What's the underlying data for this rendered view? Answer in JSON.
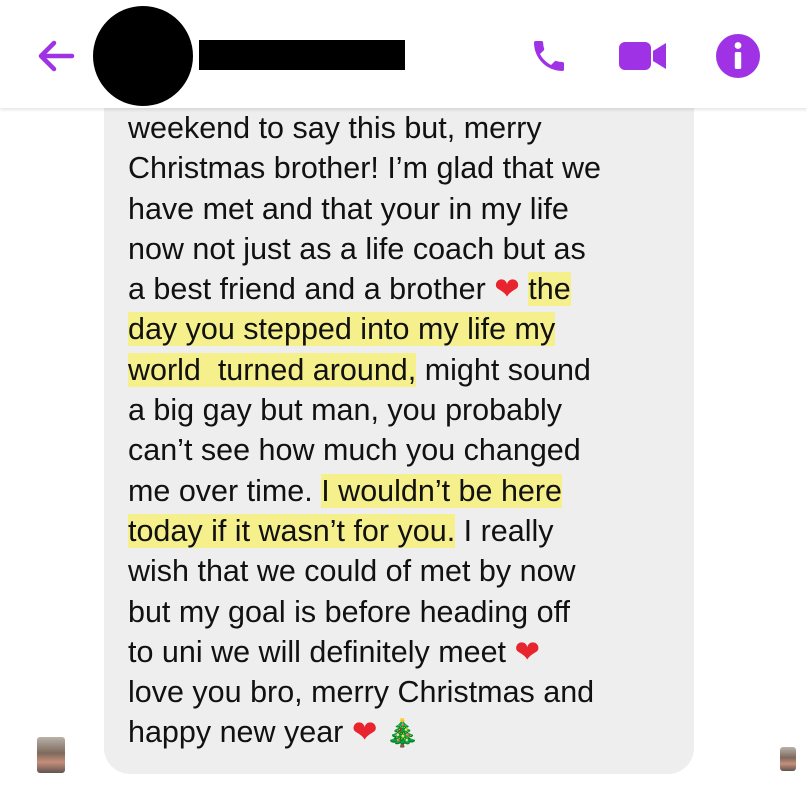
{
  "header": {
    "back_icon": "back-arrow-icon",
    "call_icon": "phone-icon",
    "video_icon": "video-camera-icon",
    "info_icon": "info-icon",
    "accent_color": "#a032e6"
  },
  "message": {
    "segments": [
      {
        "text": "weekend to say this but, merry\nChristmas brother! I’m glad that we\nhave met and that your in my life\nnow not just as a life coach but as\na best friend and a brother "
      },
      {
        "emoji": "❤",
        "icon": "red-heart-icon"
      },
      {
        "text": " "
      },
      {
        "text": "the\nday you stepped into my life my\nworld  turned around,",
        "highlight": true
      },
      {
        "text": " might sound\na big gay but man, you probably\ncan’t see how much you changed\nme over time. "
      },
      {
        "text": "I wouldn’t be here\ntoday if it wasn’t for you.",
        "highlight": true
      },
      {
        "text": " I really\nwish that we could of met by now\nbut my goal is before heading off\nto uni we will definitely meet "
      },
      {
        "emoji": "❤",
        "icon": "red-heart-icon"
      },
      {
        "text": "\nlove you bro, merry Christmas and\nhappy new year "
      },
      {
        "emoji": "❤",
        "icon": "red-heart-icon"
      },
      {
        "text": " "
      },
      {
        "emoji": "🎄",
        "icon": "christmas-tree-icon"
      }
    ],
    "bubble_color": "#eeeeee",
    "highlight_color": "#f5f08c"
  }
}
